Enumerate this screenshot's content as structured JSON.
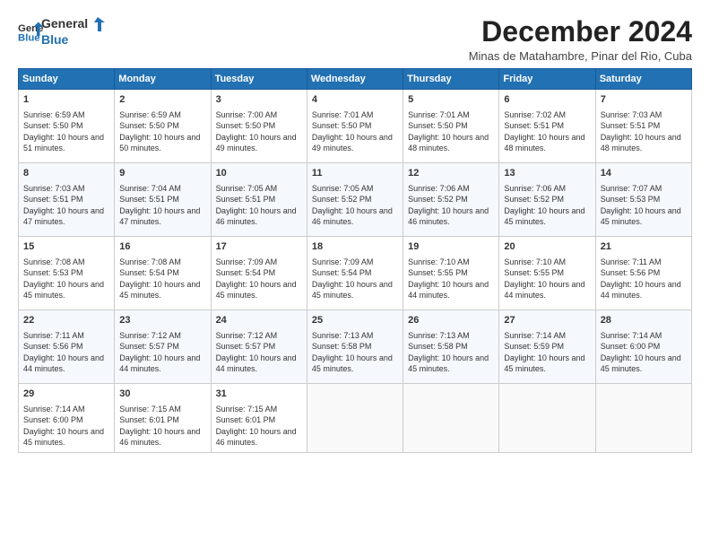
{
  "header": {
    "logo_line1": "General",
    "logo_line2": "Blue",
    "month": "December 2024",
    "location": "Minas de Matahambre, Pinar del Rio, Cuba"
  },
  "days_of_week": [
    "Sunday",
    "Monday",
    "Tuesday",
    "Wednesday",
    "Thursday",
    "Friday",
    "Saturday"
  ],
  "weeks": [
    [
      {
        "day": 1,
        "sunrise": "6:59 AM",
        "sunset": "5:50 PM",
        "daylight": "10 hours and 51 minutes."
      },
      {
        "day": 2,
        "sunrise": "6:59 AM",
        "sunset": "5:50 PM",
        "daylight": "10 hours and 50 minutes."
      },
      {
        "day": 3,
        "sunrise": "7:00 AM",
        "sunset": "5:50 PM",
        "daylight": "10 hours and 49 minutes."
      },
      {
        "day": 4,
        "sunrise": "7:01 AM",
        "sunset": "5:50 PM",
        "daylight": "10 hours and 49 minutes."
      },
      {
        "day": 5,
        "sunrise": "7:01 AM",
        "sunset": "5:50 PM",
        "daylight": "10 hours and 48 minutes."
      },
      {
        "day": 6,
        "sunrise": "7:02 AM",
        "sunset": "5:51 PM",
        "daylight": "10 hours and 48 minutes."
      },
      {
        "day": 7,
        "sunrise": "7:03 AM",
        "sunset": "5:51 PM",
        "daylight": "10 hours and 48 minutes."
      }
    ],
    [
      {
        "day": 8,
        "sunrise": "7:03 AM",
        "sunset": "5:51 PM",
        "daylight": "10 hours and 47 minutes."
      },
      {
        "day": 9,
        "sunrise": "7:04 AM",
        "sunset": "5:51 PM",
        "daylight": "10 hours and 47 minutes."
      },
      {
        "day": 10,
        "sunrise": "7:05 AM",
        "sunset": "5:51 PM",
        "daylight": "10 hours and 46 minutes."
      },
      {
        "day": 11,
        "sunrise": "7:05 AM",
        "sunset": "5:52 PM",
        "daylight": "10 hours and 46 minutes."
      },
      {
        "day": 12,
        "sunrise": "7:06 AM",
        "sunset": "5:52 PM",
        "daylight": "10 hours and 46 minutes."
      },
      {
        "day": 13,
        "sunrise": "7:06 AM",
        "sunset": "5:52 PM",
        "daylight": "10 hours and 45 minutes."
      },
      {
        "day": 14,
        "sunrise": "7:07 AM",
        "sunset": "5:53 PM",
        "daylight": "10 hours and 45 minutes."
      }
    ],
    [
      {
        "day": 15,
        "sunrise": "7:08 AM",
        "sunset": "5:53 PM",
        "daylight": "10 hours and 45 minutes."
      },
      {
        "day": 16,
        "sunrise": "7:08 AM",
        "sunset": "5:54 PM",
        "daylight": "10 hours and 45 minutes."
      },
      {
        "day": 17,
        "sunrise": "7:09 AM",
        "sunset": "5:54 PM",
        "daylight": "10 hours and 45 minutes."
      },
      {
        "day": 18,
        "sunrise": "7:09 AM",
        "sunset": "5:54 PM",
        "daylight": "10 hours and 45 minutes."
      },
      {
        "day": 19,
        "sunrise": "7:10 AM",
        "sunset": "5:55 PM",
        "daylight": "10 hours and 44 minutes."
      },
      {
        "day": 20,
        "sunrise": "7:10 AM",
        "sunset": "5:55 PM",
        "daylight": "10 hours and 44 minutes."
      },
      {
        "day": 21,
        "sunrise": "7:11 AM",
        "sunset": "5:56 PM",
        "daylight": "10 hours and 44 minutes."
      }
    ],
    [
      {
        "day": 22,
        "sunrise": "7:11 AM",
        "sunset": "5:56 PM",
        "daylight": "10 hours and 44 minutes."
      },
      {
        "day": 23,
        "sunrise": "7:12 AM",
        "sunset": "5:57 PM",
        "daylight": "10 hours and 44 minutes."
      },
      {
        "day": 24,
        "sunrise": "7:12 AM",
        "sunset": "5:57 PM",
        "daylight": "10 hours and 44 minutes."
      },
      {
        "day": 25,
        "sunrise": "7:13 AM",
        "sunset": "5:58 PM",
        "daylight": "10 hours and 45 minutes."
      },
      {
        "day": 26,
        "sunrise": "7:13 AM",
        "sunset": "5:58 PM",
        "daylight": "10 hours and 45 minutes."
      },
      {
        "day": 27,
        "sunrise": "7:14 AM",
        "sunset": "5:59 PM",
        "daylight": "10 hours and 45 minutes."
      },
      {
        "day": 28,
        "sunrise": "7:14 AM",
        "sunset": "6:00 PM",
        "daylight": "10 hours and 45 minutes."
      }
    ],
    [
      {
        "day": 29,
        "sunrise": "7:14 AM",
        "sunset": "6:00 PM",
        "daylight": "10 hours and 45 minutes."
      },
      {
        "day": 30,
        "sunrise": "7:15 AM",
        "sunset": "6:01 PM",
        "daylight": "10 hours and 46 minutes."
      },
      {
        "day": 31,
        "sunrise": "7:15 AM",
        "sunset": "6:01 PM",
        "daylight": "10 hours and 46 minutes."
      },
      null,
      null,
      null,
      null
    ]
  ]
}
